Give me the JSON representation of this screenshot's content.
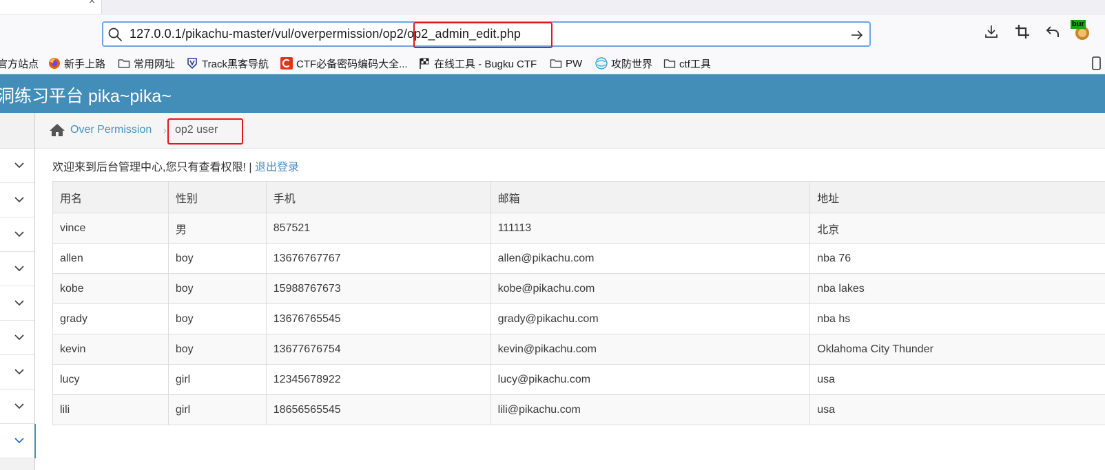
{
  "browser": {
    "url_prefix": "127.0.0.1/pikachu-master/vul/overpermission/op2/",
    "url_highlight": "op2_admin_edit.php",
    "tab_close": "×",
    "extension_label": "bur"
  },
  "bookmarks": [
    {
      "label": "官方站点",
      "icon": "none"
    },
    {
      "label": "新手上路",
      "icon": "firefox-icon"
    },
    {
      "label": "常用网址",
      "icon": "folder-icon"
    },
    {
      "label": "Track黑客导航",
      "icon": "track-icon"
    },
    {
      "label": "CTF必备密码编码大全...",
      "icon": "c-logo-icon"
    },
    {
      "label": "在线工具 - Bugku CTF",
      "icon": "flag-icon"
    },
    {
      "label": "PW",
      "icon": "folder-icon"
    },
    {
      "label": "攻防世界",
      "icon": "globe-icon"
    },
    {
      "label": "ctf工具",
      "icon": "folder-icon"
    }
  ],
  "header": {
    "brand": "洞练习平台 pika~pika~"
  },
  "breadcrumb": {
    "home_label": "Over Permission",
    "separator": "›",
    "current": "op2 user"
  },
  "welcome": {
    "text": "欢迎来到后台管理中心,您只有查看权限! | ",
    "logout": "退出登录"
  },
  "table": {
    "headers": [
      "用名",
      "性别",
      "手机",
      "邮箱",
      "地址"
    ],
    "rows": [
      [
        "vince",
        "男",
        "857521",
        "111113",
        "北京"
      ],
      [
        "allen",
        "boy",
        "13676767767",
        "allen@pikachu.com",
        "nba 76"
      ],
      [
        "kobe",
        "boy",
        "15988767673",
        "kobe@pikachu.com",
        "nba lakes"
      ],
      [
        "grady",
        "boy",
        "13676765545",
        "grady@pikachu.com",
        "nba hs"
      ],
      [
        "kevin",
        "boy",
        "13677676754",
        "kevin@pikachu.com",
        "Oklahoma City Thunder"
      ],
      [
        "lucy",
        "girl",
        "12345678922",
        "lucy@pikachu.com",
        "usa"
      ],
      [
        "lili",
        "girl",
        "18656565545",
        "lili@pikachu.com",
        "usa"
      ]
    ]
  },
  "colors": {
    "header_bg": "#438eb9",
    "link": "#4c8fbd",
    "highlight_box": "#e8141b"
  }
}
